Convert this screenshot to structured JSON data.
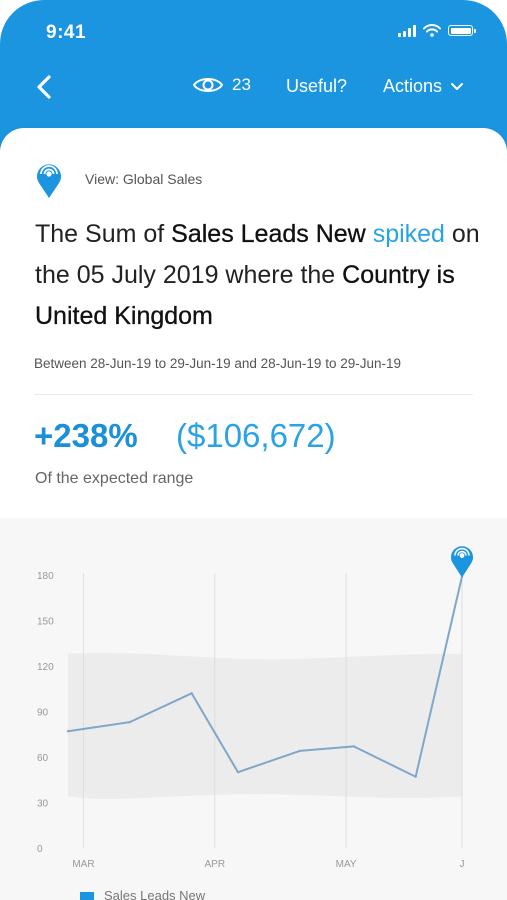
{
  "status": {
    "time": "9:41"
  },
  "nav": {
    "views_count": "23",
    "useful_label": "Useful?",
    "actions_label": "Actions"
  },
  "card": {
    "view_label": "View: Global Sales",
    "headline": {
      "part1": "The Sum of ",
      "bold1": "Sales Leads New",
      "space": " ",
      "highlight": "spiked",
      "part2": " on the 05 July 2019 where the ",
      "bold2": "Country is United Kingdom"
    },
    "date_range": "Between 28-Jun-19 to 29-Jun-19 and 28-Jun-19 to 29-Jun-19",
    "metric_pct": "+238%",
    "metric_value": "($106,672)",
    "metric_caption": "Of the expected range"
  },
  "chart_data": {
    "type": "line",
    "y_ticks": [
      "180",
      "150",
      "120",
      "90",
      "60",
      "30",
      "0"
    ],
    "x_ticks": [
      "MAR",
      "APR",
      "MAY",
      "J"
    ],
    "ylim": [
      0,
      180
    ],
    "series": [
      {
        "name": "Sales Leads New",
        "x": [
          0,
          0.8,
          1.6,
          2.2,
          3.0,
          3.7,
          4.5,
          5.1
        ],
        "values": [
          77,
          83,
          102,
          50,
          64,
          67,
          47,
          179
        ]
      }
    ],
    "expected_range": {
      "x": [
        0,
        5.1
      ],
      "upper": [
        128,
        128
      ],
      "lower": [
        34,
        34
      ]
    },
    "x_tick_positions": [
      0.2,
      1.9,
      3.6,
      5.1
    ],
    "colors": {
      "line": "#7fa7c9",
      "band": "#ececec",
      "grid": "#dedede",
      "accent": "#1b95e0"
    }
  },
  "legend": {
    "label": "Sales Leads New"
  }
}
